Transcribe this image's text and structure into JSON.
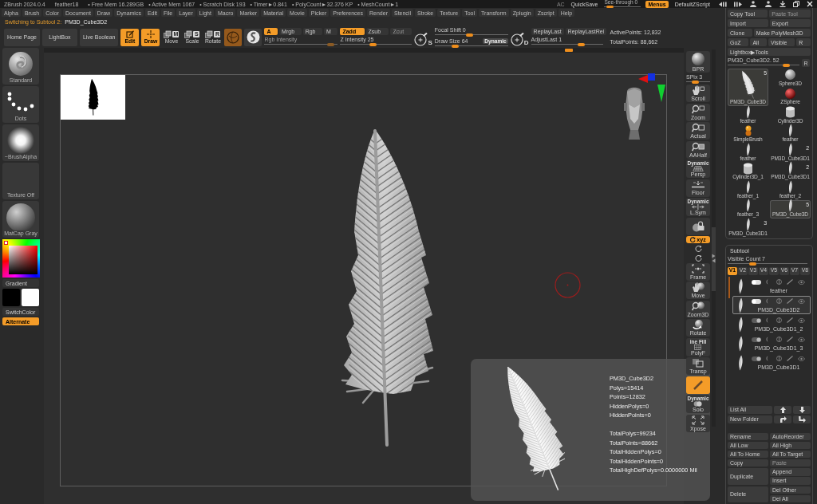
{
  "title_bar": {
    "items": [
      "ZBrush 2024.0.4",
      "feather18",
      "• Free Mem 16.289GB",
      "• Active Mem 1067",
      "• Scratch Disk 193",
      "• Timer►0.841",
      "• PolyCount►32.376 KP",
      "• MeshCount►1"
    ],
    "ac": "AC",
    "quicksave": "QuickSave",
    "see_through": {
      "label": "See-through 0",
      "level": 0.08
    },
    "menus": {
      "label": "Menus",
      "on": true
    },
    "script": "DefaultZScript"
  },
  "menu_bar": [
    "Alpha",
    "Brush",
    "Color",
    "Document",
    "Draw",
    "Dynamics",
    "Edit",
    "File",
    "Layer",
    "Light",
    "Macro",
    "Marker",
    "Material",
    "Movie",
    "Picker",
    "Preferences",
    "Render",
    "Stencil",
    "Stroke",
    "Texture",
    "Tool",
    "Transform",
    "Zplugin",
    "Zscript",
    "Help"
  ],
  "notice": {
    "label": "Switching to Subtool 2:",
    "value": "PM3D_Cube3D2"
  },
  "top_shelf": {
    "nav_buttons": [
      "Home Page",
      "LightBox",
      "Live Boolean"
    ],
    "modes": [
      {
        "kind": "edit",
        "label": "Edit",
        "on": true
      },
      {
        "kind": "draw",
        "label": "Draw",
        "on": true
      },
      {
        "kind": "move",
        "label": "Move",
        "key": "M",
        "on": false
      },
      {
        "kind": "scale",
        "label": "Scale",
        "key": "S",
        "on": false
      },
      {
        "kind": "rotate",
        "label": "Rotate",
        "key": "R",
        "on": false
      }
    ],
    "color_modes": [
      {
        "label": "A",
        "on": true
      },
      {
        "label": "Mrgb",
        "on": false
      },
      {
        "label": "Rgb",
        "on": false
      },
      {
        "label": "M",
        "on": false
      }
    ],
    "depth_modes": [
      {
        "label": "Zadd",
        "on": true,
        "disabled": false
      },
      {
        "label": "Zsub",
        "on": false,
        "disabled": false
      },
      {
        "label": "Zcut",
        "on": false,
        "disabled": true
      }
    ],
    "rgb_intensity": {
      "label": "Rgb Intensity",
      "level": 0.95,
      "disabled": true
    },
    "z_intensity": {
      "label": "Z Intensity 25",
      "level": 0.45,
      "disabled": false
    },
    "s_key": "S",
    "focal_shift": {
      "label": "Focal Shift 0",
      "level": 0.47
    },
    "draw_size": {
      "label": "Draw Size 64",
      "level": 0.26
    },
    "dynamic": "Dynamic",
    "d_key": "D",
    "replay_buttons": [
      "ReplayLast",
      "ReplayLastRel"
    ],
    "adjust_last": {
      "label": "AdjustLast 1",
      "level": 0.72
    },
    "active_points": "ActivePoints: 12,832",
    "total_points": "TotalPoints: 88,662"
  },
  "left_shelf": {
    "tiles": [
      {
        "kind": "brush",
        "label": "Standard"
      },
      {
        "kind": "stroke",
        "label": "Dots"
      },
      {
        "kind": "alpha",
        "label": "~BrushAlpha"
      },
      {
        "kind": "texture",
        "label": "Texture Off"
      },
      {
        "kind": "material",
        "label": "MatCap Gray"
      }
    ],
    "gradient": "Gradient",
    "swatches": [
      {
        "color": "#000000"
      },
      {
        "color": "#ffffff"
      }
    ],
    "switch_color": "SwitchColor",
    "alternate": {
      "label": "Alternate",
      "on": true
    }
  },
  "info_panel": {
    "mesh": [
      "PM3D_Cube3D2",
      "Polys=15414",
      "Points=12832",
      "HiddenPolys=0",
      "HiddenPoints=0"
    ],
    "totals": [
      "TotalPolys=99234",
      "TotalPoints=88662",
      "TotalHiddenPolys=0",
      "TotalHiddenPoints=0",
      "TotalHighDefPolys=0.0000000 Mil"
    ]
  },
  "right_shelf": [
    {
      "kind": "render",
      "label": "BPR",
      "on": false
    },
    {
      "kind": "slider",
      "label": "SPix 3",
      "level": 0.35
    },
    {
      "kind": "pan",
      "label": "Scroll",
      "on": false
    },
    {
      "kind": "zoom",
      "label": "Zoom",
      "on": false
    },
    {
      "kind": "actual",
      "label": "Actual",
      "on": false
    },
    {
      "kind": "half",
      "label": "AAHalf",
      "on": false
    },
    {
      "kind": "perspective",
      "label": "Persp",
      "tag": "Dynamic",
      "on": false
    },
    {
      "kind": "floor",
      "label": "Floor",
      "on": false
    },
    {
      "kind": "symmetry",
      "label": "L.Sym",
      "tag": "Dynamic",
      "on": false
    },
    {
      "kind": "lock",
      "on": false
    },
    {
      "kind": "axes",
      "label": "xyz",
      "on": true
    },
    {
      "kind": "rotate-y",
      "on": false
    },
    {
      "kind": "rotate-z",
      "on": false
    },
    {
      "kind": "frame",
      "label": "Frame",
      "on": false
    },
    {
      "kind": "move",
      "label": "Move",
      "on": false
    },
    {
      "kind": "zoom3d",
      "label": "Zoom3D",
      "on": false
    },
    {
      "kind": "rotate",
      "label": "Rotate",
      "on": false
    },
    {
      "kind": "polyframe",
      "label": "PolyF",
      "tag": "ine Fill",
      "on": false
    },
    {
      "kind": "transparency",
      "label": "Transp",
      "on": false
    },
    {
      "kind": "ghost",
      "on": true
    },
    {
      "kind": "solo",
      "label": "Solo",
      "tag": "Dynamic",
      "on": false
    },
    {
      "kind": "xpose",
      "label": "Xpose",
      "on": false
    }
  ],
  "tool_panel": {
    "button_rows": [
      [
        {
          "label": "Copy Tool",
          "disabled": false
        },
        {
          "label": "Paste Tool",
          "disabled": true
        }
      ],
      [
        {
          "label": "Import",
          "disabled": false
        },
        {
          "label": "Export",
          "disabled": false
        }
      ],
      [
        {
          "label": "Clone",
          "disabled": false
        },
        {
          "label": "Make PolyMesh3D",
          "disabled": false
        }
      ],
      [
        {
          "label": "GoZ",
          "disabled": false
        },
        {
          "label": "All",
          "disabled": false
        },
        {
          "label": "Visible",
          "disabled": false
        },
        {
          "label": "R",
          "disabled": false
        }
      ]
    ],
    "lightbox": "Lightbox▶Tools",
    "tool_slider": {
      "label": "PM3D_Cube3D2. 52",
      "level": 0.85
    },
    "tool_slider_reset": "R",
    "current_tool": {
      "kind": "feather",
      "label": "PM3D_Cube3D",
      "badge": "5",
      "selected": true
    },
    "tools": [
      {
        "kind": "feather",
        "label": "feather",
        "selected": false
      },
      {
        "kind": "brush",
        "label": "SimpleBrush",
        "selected": false
      },
      {
        "kind": "feather",
        "label": "feather",
        "selected": false
      },
      {
        "kind": "cylinder",
        "label": "Cylinder3D_1",
        "selected": false
      },
      {
        "kind": "feather",
        "label": "feather_1",
        "selected": false
      },
      {
        "kind": "feather",
        "label": "feather_3",
        "selected": false
      },
      {
        "kind": "feather",
        "label": "PM3D_Cube3D1",
        "badge": "3",
        "selected": false
      },
      {
        "kind": "sphere",
        "label": "Sphere3D",
        "selected": false
      },
      {
        "kind": "zsphere",
        "label": "ZSphere",
        "selected": false
      },
      {
        "kind": "cylinder",
        "label": "Cylinder3D",
        "selected": false
      },
      {
        "kind": "feather",
        "label": "feather",
        "selected": false
      },
      {
        "kind": "feather",
        "label": "PM3D_Cube3D1",
        "badge": "2",
        "selected": false
      },
      {
        "kind": "feather",
        "label": "PM3D_Cube3D1",
        "badge": "2",
        "selected": false
      },
      {
        "kind": "feather",
        "label": "feather_2",
        "selected": false
      },
      {
        "kind": "feather",
        "label": "PM3D_Cube3D",
        "badge": "5",
        "selected": true
      }
    ]
  },
  "subtool": {
    "title": "Subtool",
    "visible_count": {
      "label": "Visible Count 7",
      "level": 0.3
    },
    "versions": [
      {
        "label": "V1",
        "selected": true
      },
      {
        "label": "V2",
        "selected": false
      },
      {
        "label": "V3",
        "selected": false
      },
      {
        "label": "V4",
        "selected": false
      },
      {
        "label": "V5",
        "selected": false
      },
      {
        "label": "V6",
        "selected": false
      },
      {
        "label": "V7",
        "selected": false
      },
      {
        "label": "V8",
        "selected": false
      }
    ],
    "items": [
      {
        "label": "feather",
        "selected": false,
        "toggle_on": true
      },
      {
        "label": "PM3D_Cube3D2",
        "selected": true,
        "toggle_on": true
      },
      {
        "label": "PM3D_Cube3D1_2",
        "selected": false,
        "toggle_on": false
      },
      {
        "label": "PM3D_Cube3D1_3",
        "selected": false,
        "toggle_on": false
      },
      {
        "label": "PM3D_Cube3D1",
        "selected": false,
        "toggle_on": false
      }
    ],
    "list_all": "List All",
    "new_folder": "New Folder",
    "actions": [
      {
        "label": "Rename",
        "disabled": false
      },
      {
        "label": "AutoReorder",
        "disabled": false
      },
      {
        "label": "All Low",
        "disabled": false
      },
      {
        "label": "All High",
        "disabled": false
      },
      {
        "label": "All To Home",
        "disabled": false
      },
      {
        "label": "All To Target",
        "disabled": false
      },
      {
        "label": "Copy",
        "disabled": false
      },
      {
        "label": "Paste",
        "disabled": true
      }
    ],
    "duplicate": {
      "label": "Duplicate",
      "disabled": false
    },
    "add_buttons": [
      {
        "label": "Append",
        "disabled": false
      },
      {
        "label": "Insert",
        "disabled": false
      }
    ],
    "delete": {
      "label": "Delete",
      "disabled": false
    },
    "remove_buttons": [
      {
        "label": "Del Other",
        "disabled": false
      },
      {
        "label": "Del All",
        "disabled": false
      }
    ]
  }
}
